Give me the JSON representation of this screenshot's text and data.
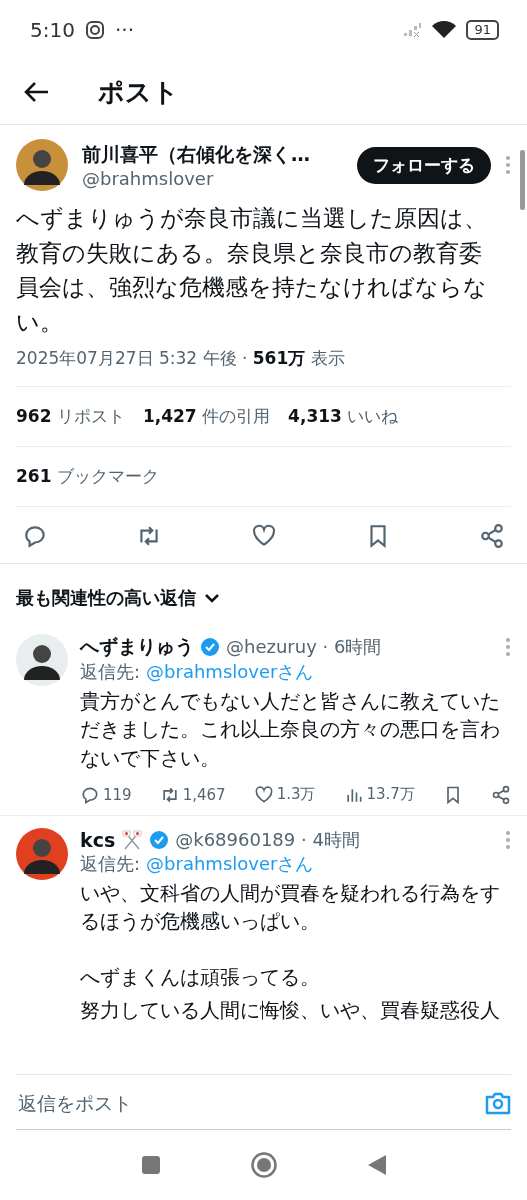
{
  "status_bar": {
    "time": "5:10",
    "more": "···",
    "battery": "91"
  },
  "header": {
    "title": "ポスト"
  },
  "post": {
    "author": {
      "name": "前川喜平（右傾化を深く…",
      "handle": "@brahmslover"
    },
    "follow_button": "フォローする",
    "text": "へずまりゅうが奈良市議に当選した原因は、教育の失敗にある。奈良県と奈良市の教育委員会は、強烈な危機感を持たなければならない。",
    "meta": "2025年07月27日 5:32 午後 · **561万** 表示",
    "stats": [
      "**962** リポスト",
      "**1,427** 件の引用",
      "**4,313** いいね"
    ],
    "bookmarks": "**261** ブックマーク"
  },
  "sort_label": "最も関連性の高い返信",
  "replies": [
    {
      "name": "へずまりゅう",
      "verified": true,
      "emoji": false,
      "handle": "@hezuruy · 6時間",
      "reply_to_label": "返信先:",
      "reply_to": "@brahmsloverさん",
      "text": "貴方がとんでもない人だと皆さんに教えていただきました。これ以上奈良の方々の悪口を言わないで下さい。",
      "counts": {
        "replies": "119",
        "reposts": "1,467",
        "likes": "1.3万",
        "views": "13.7万"
      }
    },
    {
      "name": "kcs",
      "verified": true,
      "emoji": true,
      "handle": "@k68960189 · 4時間",
      "reply_to_label": "返信先:",
      "reply_to": "@brahmsloverさん",
      "paragraphs": [
        [
          "いや、文科省の人間が買春を疑われる行為をするほうが危機感いっぱい。"
        ],
        [
          "へずまくんは頑張ってる。",
          "努力している人間に悔悛、いや、買春疑惑役人"
        ]
      ]
    }
  ],
  "composer": {
    "placeholder": "返信をポスト"
  }
}
